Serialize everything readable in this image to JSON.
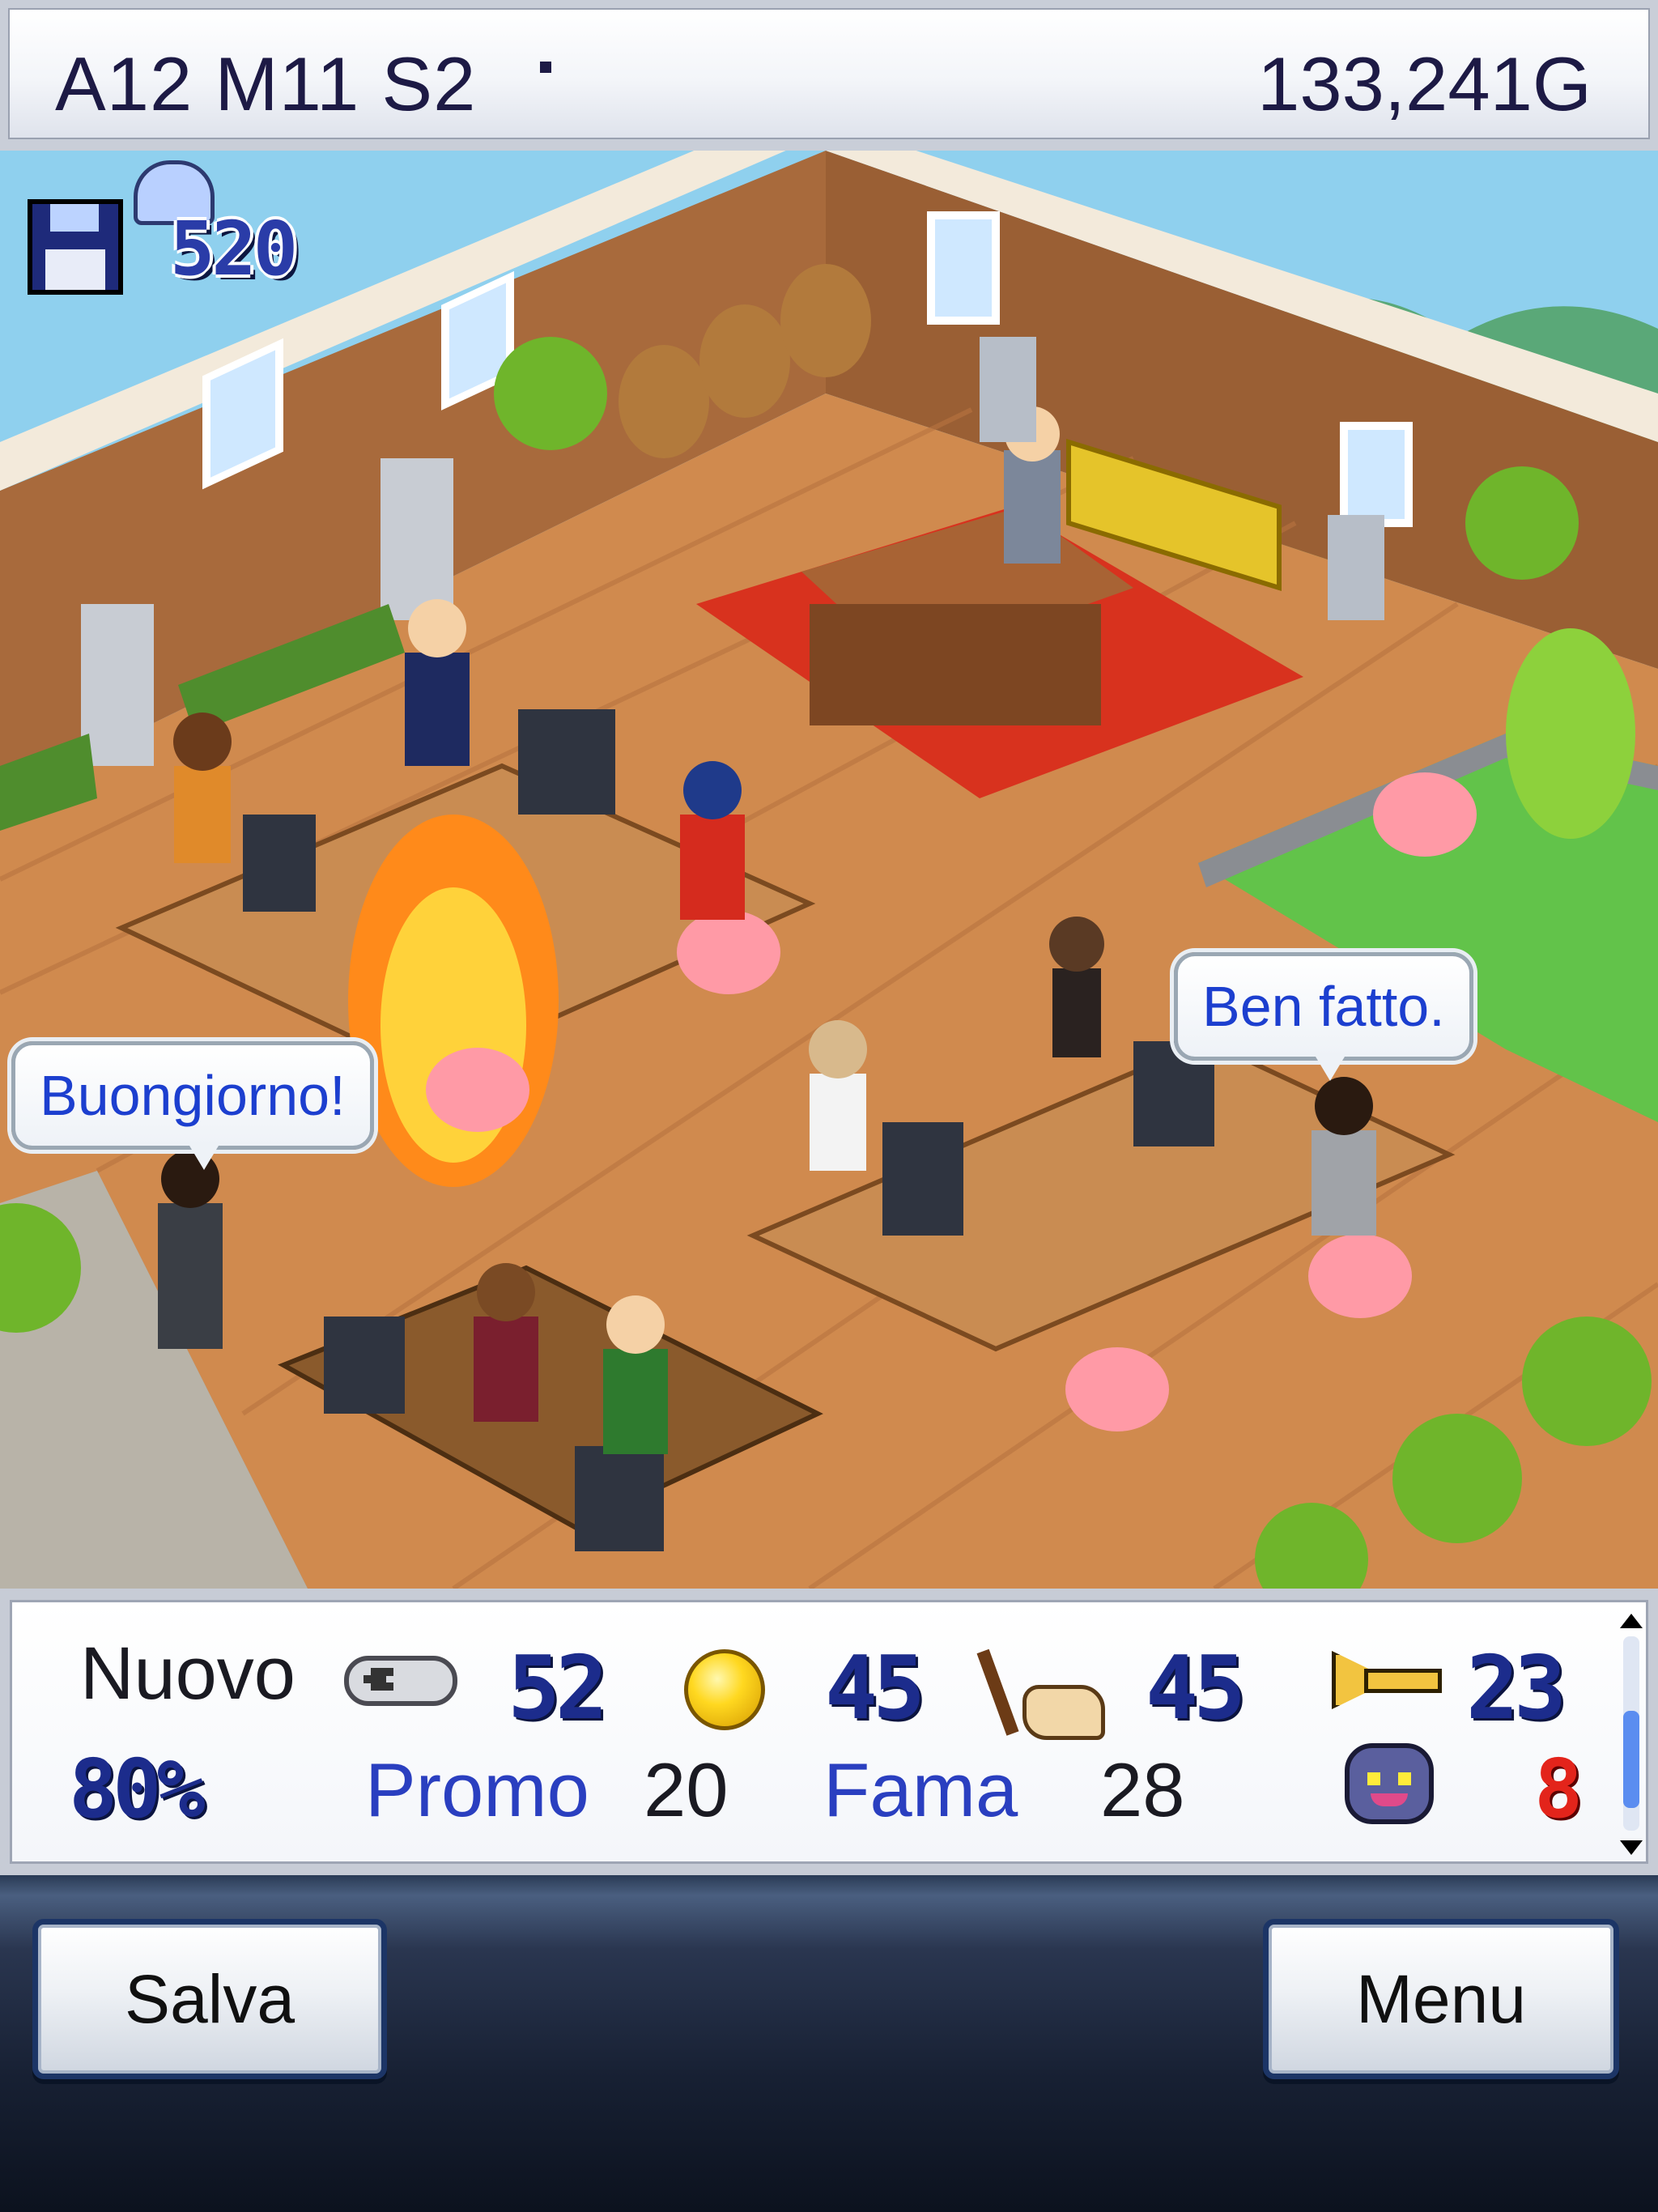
{
  "header": {
    "date": "A12 M11 S2",
    "money": "133,241G"
  },
  "hud": {
    "research_points": "520",
    "icons": [
      "save-disk-icon",
      "ghost-icon"
    ]
  },
  "speech_bubbles": [
    {
      "text": "Buongiorno!"
    },
    {
      "text": "Ben fatto."
    }
  ],
  "status": {
    "game_title": "Nuovo",
    "progress": "80%",
    "fun": "52",
    "creativity": "45",
    "graphics": "45",
    "sound": "23",
    "promo_label": "Promo",
    "promo_value": "20",
    "fame_label": "Fama",
    "fame_value": "28",
    "bugs": "8",
    "icons": [
      "gamepad-icon",
      "coin-icon",
      "paintbrush-icon",
      "trumpet-icon",
      "bug-icon"
    ]
  },
  "buttons": {
    "save_label": "Salva",
    "menu_label": "Menu"
  }
}
